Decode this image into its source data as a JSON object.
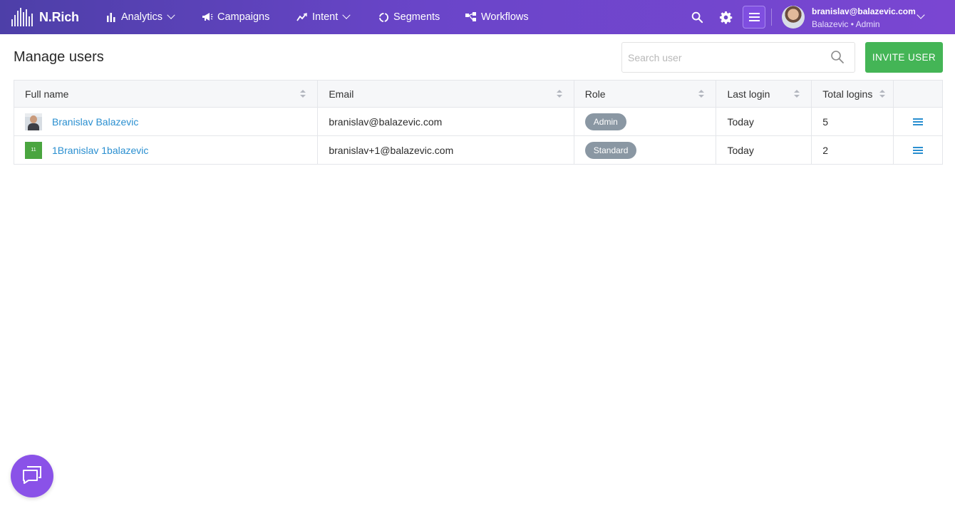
{
  "brand": {
    "name": "N.Rich"
  },
  "nav": {
    "analytics": "Analytics",
    "campaigns": "Campaigns",
    "intent": "Intent",
    "segments": "Segments",
    "workflows": "Workflows"
  },
  "user": {
    "email": "branislav@balazevic.com",
    "subtitle": "Balazevic • Admin"
  },
  "page": {
    "title": "Manage users",
    "search_placeholder": "Search user",
    "invite_label": "INVITE USER"
  },
  "table": {
    "headers": [
      "Full name",
      "Email",
      "Role",
      "Last login",
      "Total logins"
    ],
    "rows": [
      {
        "name": "Branislav Balazevic",
        "email": "branislav@balazevic.com",
        "role": "Admin",
        "last_login": "Today",
        "total_logins": "5",
        "initials": ""
      },
      {
        "name": "1Branislav 1balazevic",
        "email": "branislav+1@balazevic.com",
        "role": "Standard",
        "last_login": "Today",
        "total_logins": "2",
        "initials": "11"
      }
    ]
  },
  "colors": {
    "nav_gradient_start": "#4d3fa8",
    "nav_gradient_end": "#7a46d2",
    "invite_green": "#44b556",
    "link_blue": "#2a8fd0",
    "badge_gray": "#8a97a3",
    "chat_purple": "#8a52e8"
  },
  "icons": {
    "analytics": "bar-chart-icon",
    "campaigns": "megaphone-icon",
    "intent": "trend-line-icon",
    "segments": "circle-segments-icon",
    "workflows": "workflow-icon",
    "search": "search-icon",
    "settings": "gear-icon",
    "menu": "hamburger-icon",
    "chat": "chat-icon"
  }
}
